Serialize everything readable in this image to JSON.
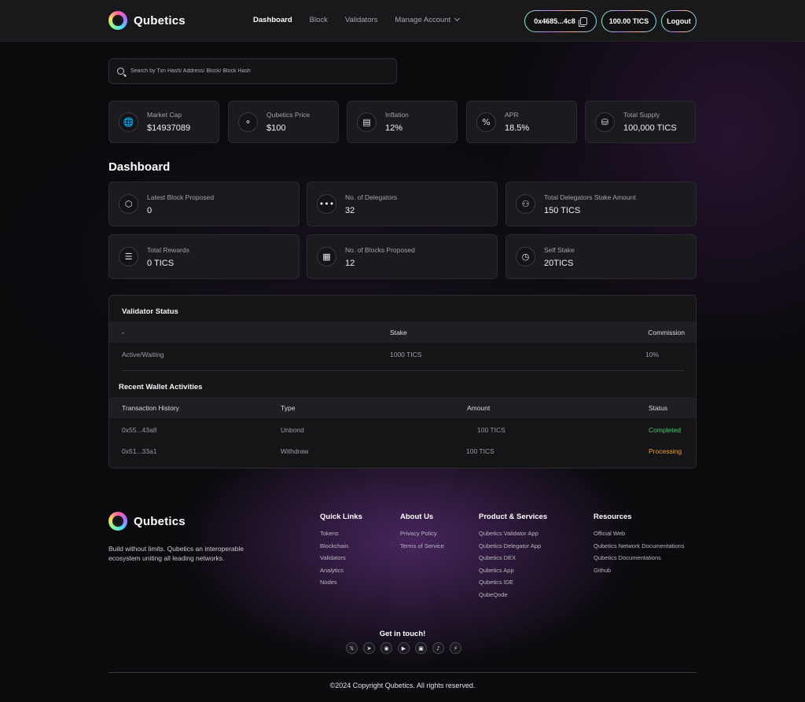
{
  "app": {
    "name": "Qubetics"
  },
  "nav": {
    "links": [
      {
        "label": "Dashboard",
        "active": true
      },
      {
        "label": "Block"
      },
      {
        "label": "Validators"
      },
      {
        "label": "Manage Account",
        "dropdown": true
      }
    ],
    "wallet_address": "0x4685...4c8",
    "balance": "100.00 TICS",
    "logout_label": "Logout"
  },
  "search": {
    "placeholder": "Search by Txn Hash/ Address/ Block/ Block Hash"
  },
  "stats": [
    {
      "label": "Market Cap",
      "value": "$14937089",
      "icon": "globe-icon"
    },
    {
      "label": "Qubetics Price",
      "value": "$100",
      "icon": "price-tag-icon"
    },
    {
      "label": "Inflation",
      "value": "12%",
      "icon": "chart-icon"
    },
    {
      "label": "APR",
      "value": "18.5%",
      "icon": "percent-icon"
    },
    {
      "label": "Total Supply",
      "value": "100,000 TICS",
      "icon": "coins-icon"
    }
  ],
  "dashboard": {
    "title": "Dashboard",
    "cards": [
      {
        "label": "Latest Block Proposed",
        "value": "0",
        "icon": "cube-icon"
      },
      {
        "label": "No. of Delegators",
        "value": "32",
        "icon": "dots-icon"
      },
      {
        "label": "Total Delegators Stake Amount",
        "value": "150 TICS",
        "icon": "stake-icon"
      },
      {
        "label": "Total Rewards",
        "value": "0 TICS",
        "icon": "layers-icon"
      },
      {
        "label": "No. of Blocks Proposed",
        "value": "12",
        "icon": "gift-icon"
      },
      {
        "label": "Self Stake",
        "value": "20TICS",
        "icon": "clock-icon"
      }
    ]
  },
  "validator_status": {
    "title": "Validator Status",
    "headers": [
      "-",
      "Stake",
      "Commission"
    ],
    "row": [
      "Active/Waiting",
      "1000 TICS",
      "10%"
    ]
  },
  "activities": {
    "title": "Recent Wallet Activities",
    "headers": [
      "Transaction History",
      "Type",
      "Amount",
      "Status"
    ],
    "rows": [
      {
        "hash": "0x55...43a8",
        "type": "Unbond",
        "amount": "100 TICS",
        "status": "Completed"
      },
      {
        "hash": "0x51...33a1",
        "type": "Withdraw",
        "amount": "100 TICS",
        "status": "Processing"
      }
    ]
  },
  "colors": {
    "completed": "#3fcf6a",
    "processing": "#f0a02a"
  },
  "footer": {
    "tagline": "Build without limits. Qubetics an interoperable ecosystem uniting all leading networks.",
    "columns": [
      {
        "title": "Quick Links",
        "items": [
          "Tokens",
          "Blockchain",
          "Validators",
          "Analytics",
          "Nodes"
        ]
      },
      {
        "title": "About Us",
        "items": [
          "Privacy Policy",
          "Terms of Service"
        ]
      },
      {
        "title": "Product & Services",
        "items": [
          "Qubetics Validator App",
          "Qubetics Delegator App",
          "Qubetics DEX",
          "Qubetics App",
          "Qubetics IDE",
          "QubeQode"
        ]
      },
      {
        "title": "Resources",
        "items": [
          "Official Web",
          "Qubetics Network Documentations",
          "Qubetics Documentations",
          "Github"
        ]
      }
    ],
    "get_in_touch": "Get in touch!",
    "socials": [
      "x-icon",
      "telegram-icon",
      "discord-icon",
      "youtube-icon",
      "instagram-icon",
      "tiktok-icon",
      "messenger-icon"
    ],
    "copyright": "©2024 Copyright Qubetics. All rights reserved."
  }
}
